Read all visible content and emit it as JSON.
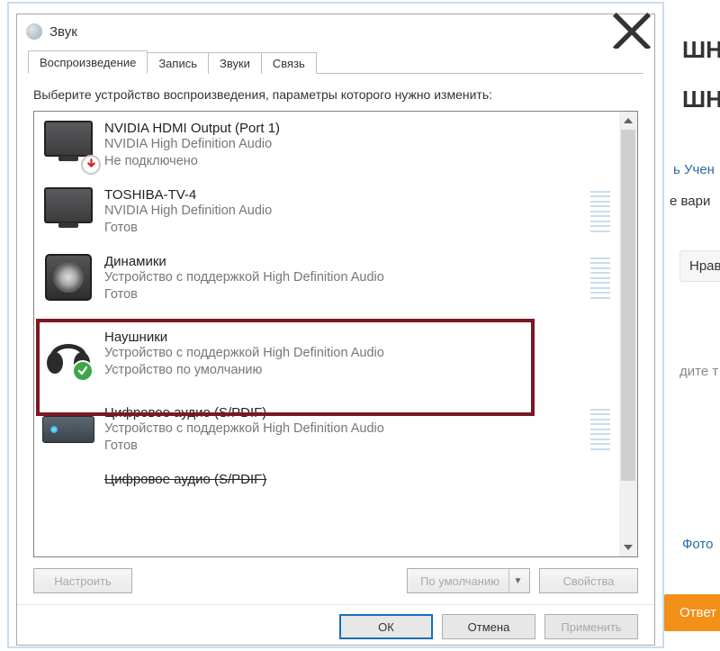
{
  "background": {
    "title1": "ШНІ",
    "title2": "ШНІ",
    "link1": "ь Учен",
    "text2": "е вари",
    "nrav": "Нравит",
    "enter": "дите т",
    "photo": "Фото",
    "answer": "Ответ"
  },
  "dialog": {
    "title": "Звук",
    "tabs": {
      "playback": "Воспроизведение",
      "record": "Запись",
      "sounds": "Звуки",
      "comm": "Связь"
    },
    "instruction": "Выберите устройство воспроизведения, параметры которого нужно изменить:",
    "devices": [
      {
        "name": "NVIDIA HDMI Output (Port 1)",
        "desc1": "NVIDIA High Definition Audio",
        "desc2": "Не подключено"
      },
      {
        "name": "TOSHIBA-TV-4",
        "desc1": "NVIDIA High Definition Audio",
        "desc2": "Готов"
      },
      {
        "name": "Динамики",
        "desc1": "Устройство с поддержкой High Definition Audio",
        "desc2": "Готов"
      },
      {
        "name": "Наушники",
        "desc1": "Устройство с поддержкой High Definition Audio",
        "desc2": "Устройство по умолчанию"
      },
      {
        "name": "Цифровое аудио (S/PDIF)",
        "desc1": "Устройство с поддержкой High Definition Audio",
        "desc2": "Готов"
      },
      {
        "name": "Цифровое аудио (S/PDIF)",
        "desc1": "",
        "desc2": ""
      }
    ],
    "buttons": {
      "configure": "Настроить",
      "default": "По умолчанию",
      "properties": "Свойства",
      "ok": "ОК",
      "cancel": "Отмена",
      "apply": "Применить"
    }
  }
}
